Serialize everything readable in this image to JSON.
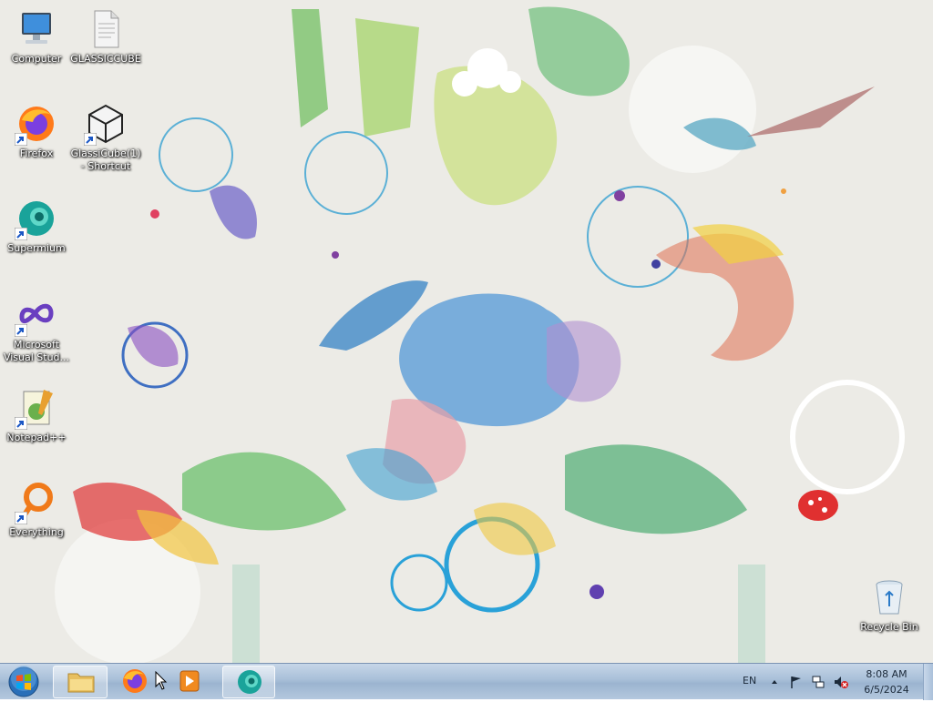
{
  "desktop": {
    "icons": [
      {
        "label": "Computer",
        "icon": "computer-icon"
      },
      {
        "label": "GLASSICCUBE",
        "icon": "text-file-icon"
      },
      {
        "label": "Firefox",
        "icon": "firefox-icon"
      },
      {
        "label": "GlassiCube(1) - Shortcut",
        "icon": "glassicube-icon"
      },
      {
        "label": "Supermium",
        "icon": "supermium-icon"
      },
      {
        "label": "Microsoft Visual Stud...",
        "icon": "visual-studio-icon"
      },
      {
        "label": "Notepad++",
        "icon": "notepad-plus-plus-icon"
      },
      {
        "label": "Everything",
        "icon": "everything-search-icon"
      },
      {
        "label": "Recycle Bin",
        "icon": "recycle-bin-icon"
      }
    ]
  },
  "taskbar": {
    "start_icon": "windows-start-orb",
    "pinned": [
      {
        "name": "file-explorer",
        "icon": "folder-icon",
        "active": true
      },
      {
        "name": "firefox",
        "icon": "firefox-icon",
        "active": false
      },
      {
        "name": "media-player",
        "icon": "media-player-icon",
        "active": false
      },
      {
        "name": "supermium",
        "icon": "supermium-icon",
        "active": true
      }
    ],
    "tray": {
      "language": "EN",
      "time": "8:08 AM",
      "date": "6/5/2024"
    }
  },
  "colors": {
    "taskbar": "#a8bfd8",
    "desktop_background": "#ecebe6"
  }
}
